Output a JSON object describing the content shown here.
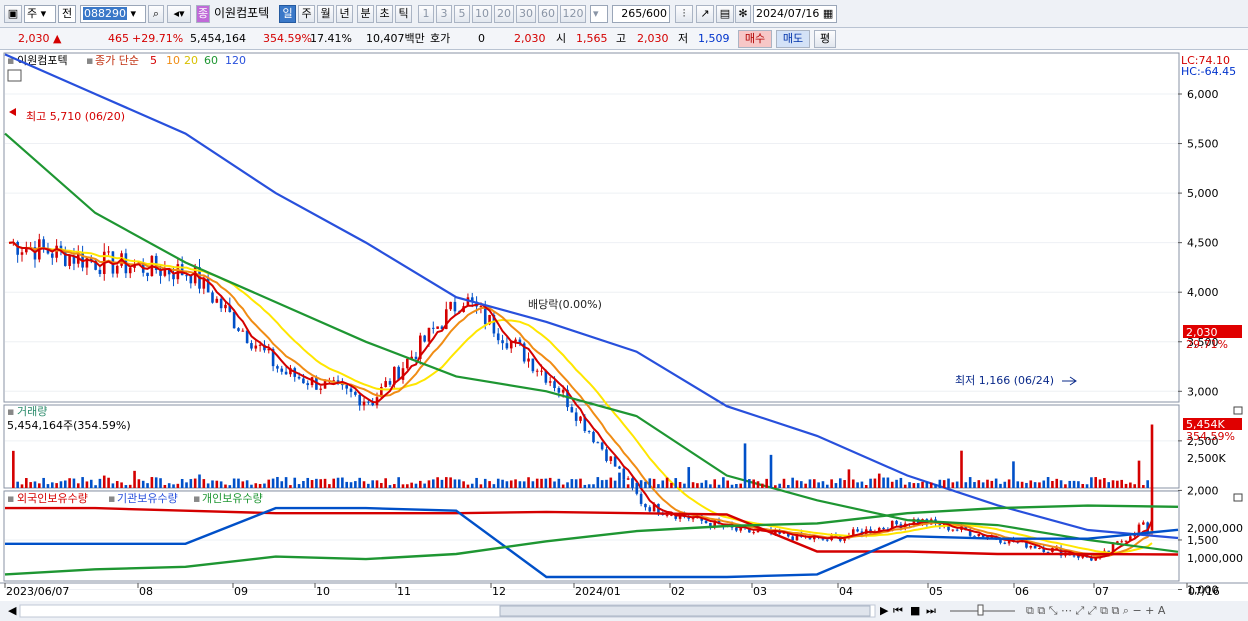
{
  "toolbar": {
    "market_type": "주",
    "period_prefix": "전",
    "code": "088290",
    "name_badge": "종",
    "stock_name": "이원컴포텍",
    "periods": [
      "일",
      "주",
      "월",
      "년",
      "분",
      "초",
      "틱"
    ],
    "period_active": "일",
    "intervals": [
      "1",
      "3",
      "5",
      "10",
      "20",
      "30",
      "60",
      "120"
    ],
    "count": "265",
    "count_total": "/600",
    "date": "2024/07/16"
  },
  "quote": {
    "price": "2,030",
    "change": "465",
    "change_pct": "+29.71%",
    "volume": "5,454,164",
    "volume_pct": "354.59%",
    "turnover": "17.41%",
    "amount": "10,407백만",
    "bid_label": "호가",
    "bid_qty": "0",
    "bid_price": "2,030",
    "open_label": "시",
    "open": "1,565",
    "high_label": "고",
    "high": "2,030",
    "low_label": "저",
    "low": "1,509",
    "buy_label": "매수",
    "sell_label": "매도",
    "eval_label": "평"
  },
  "price_panel": {
    "legend_name": "이원컴포텍",
    "legend_type": "종가 단순",
    "ma_labels": [
      "5",
      "10",
      "20",
      "60",
      "120"
    ],
    "lc": "LC:74.10",
    "hc": "HC:-64.45",
    "high_note": "최고 5,710 (06/20)",
    "low_note": "최저 1,166 (06/24)",
    "div_note": "배당락(0.00%)",
    "last_price_tag": "2,030",
    "last_pct_tag": "29.71%",
    "y_ticks": [
      "6,000",
      "5,500",
      "5,000",
      "4,500",
      "4,000",
      "3,500",
      "3,000",
      "2,500",
      "2,000",
      "1,500",
      "1,000"
    ]
  },
  "volume_panel": {
    "title": "거래량",
    "value": "5,454,164주(354.59%)",
    "tag_value": "5,454K",
    "tag_pct": "354.59%",
    "y_tick": "2,500K"
  },
  "holdings_panel": {
    "legend": [
      "외국인보유수량",
      "기관보유수량",
      "개인보유수량"
    ],
    "y_ticks": [
      "2,000,000",
      "1,000,000"
    ]
  },
  "x_labels": [
    "2023/06/07",
    "08",
    "09",
    "10",
    "11",
    "12",
    "2024/01",
    "02",
    "03",
    "04",
    "05",
    "06",
    "07",
    "07/16"
  ],
  "colors": {
    "up": "#d40000",
    "down": "#0050c8",
    "ma5": "#d40000",
    "ma10": "#f08c14",
    "ma20": "#ffe600",
    "ma60": "#1e9632",
    "ma120": "#2850dc"
  },
  "chart_data": [
    {
      "type": "line",
      "title": "이원컴포텍",
      "series": [
        {
          "name": "종가",
          "x": [
            "2023/06",
            "2023/07",
            "2023/08",
            "2023/09",
            "2023/10",
            "2023/11",
            "2023/12",
            "2024/01",
            "2024/02",
            "2024/03",
            "2024/04",
            "2024/05",
            "2024/06",
            "2024/07/16"
          ],
          "values": [
            4500,
            4300,
            4200,
            3200,
            2900,
            3950,
            3100,
            1850,
            1600,
            1500,
            1700,
            1500,
            1300,
            2030
          ]
        },
        {
          "name": "120",
          "values": [
            6400,
            6000,
            5600,
            5000,
            4500,
            3950,
            3700,
            3400,
            2850,
            2550,
            2150,
            1850,
            1600,
            1520
          ]
        },
        {
          "name": "60",
          "values": [
            5600,
            4800,
            4300,
            3900,
            3500,
            3150,
            3000,
            2750,
            2150,
            1900,
            1700,
            1650,
            1500,
            1380
          ]
        }
      ],
      "ylim": [
        900,
        6300
      ]
    },
    {
      "type": "bar",
      "title": "거래량",
      "series": [
        {
          "name": "거래량",
          "values": [
            5454164
          ]
        }
      ]
    },
    {
      "type": "line",
      "series": [
        {
          "name": "외국인보유수량",
          "values": [
            2700000,
            2700000,
            2600000,
            2500000,
            2500000,
            2500000,
            2550000,
            2500000,
            2450000,
            1000000,
            1000000,
            900000,
            900000,
            880000
          ]
        },
        {
          "name": "기관보유수량",
          "values": [
            1300000,
            1300000,
            1300000,
            2700000,
            2700000,
            2600000,
            0,
            0,
            0,
            100000,
            1600000,
            1500000,
            1500000,
            1850000
          ]
        },
        {
          "name": "개인보유수량",
          "values": [
            100000,
            300000,
            400000,
            800000,
            700000,
            900000,
            1400000,
            1800000,
            2000000,
            2100000,
            2500000,
            2700000,
            2800000,
            2750000
          ]
        }
      ],
      "ylim": [
        0,
        2900000
      ]
    }
  ]
}
